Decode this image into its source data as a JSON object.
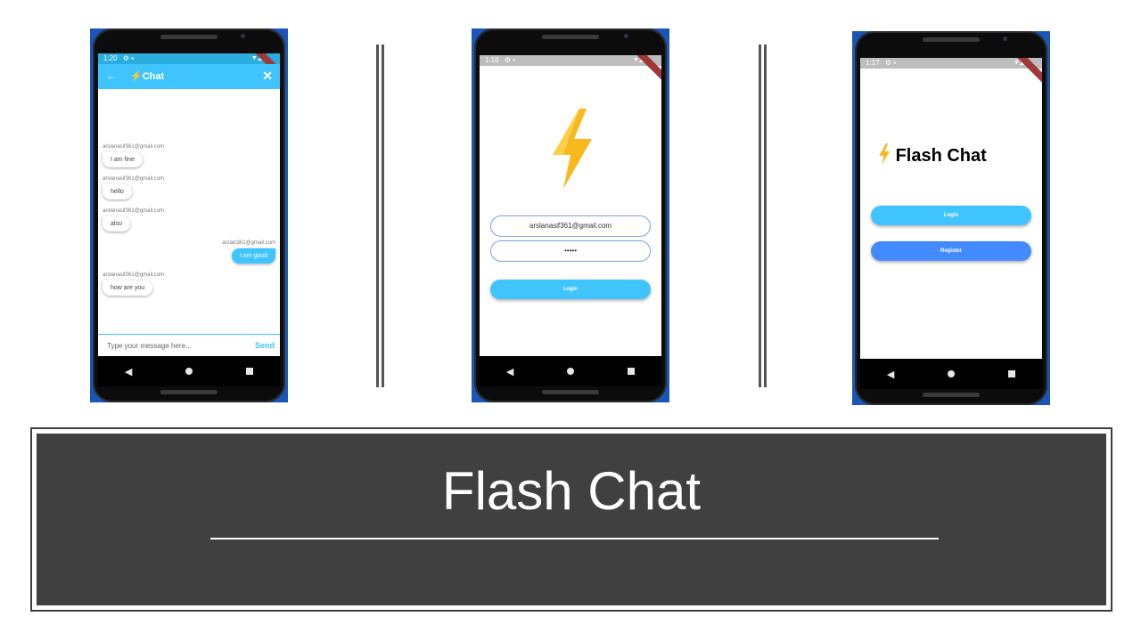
{
  "chat_screen": {
    "status": {
      "time": "1:20",
      "icons": "⚙ ▪"
    },
    "appbar": {
      "title": "Chat",
      "back_icon": "arrow-left-icon",
      "close_icon": "close-icon"
    },
    "messages": [
      {
        "sender": "arslanasif361@gmail.com",
        "text": "I am fine",
        "side": "left"
      },
      {
        "sender": "arslanasif361@gmail.com",
        "text": "hello",
        "side": "left"
      },
      {
        "sender": "arslanasif361@gmail.com",
        "text": "also",
        "side": "left"
      },
      {
        "sender": "arslan361@gmail.com",
        "text": "I am good",
        "side": "right"
      },
      {
        "sender": "arslanasif361@gmail.com",
        "text": "how are you",
        "side": "left"
      }
    ],
    "composer": {
      "placeholder": "Type your message here...",
      "send_label": "Send"
    }
  },
  "login_screen": {
    "status": {
      "time": "1:18"
    },
    "email": "arslanasif361@gmail.com",
    "password_mask": "•••••",
    "login_label": "Login"
  },
  "welcome_screen": {
    "status": {
      "time": "1:17"
    },
    "brand_title": "Flash Chat",
    "login_label": "Login",
    "register_label": "Register"
  },
  "banner": {
    "title": "Flash Chat"
  },
  "colors": {
    "accent_cyan": "#40c4ff",
    "accent_blue": "#448aff",
    "bolt_yellow": "#f9c21b",
    "banner_bg": "#404040"
  }
}
